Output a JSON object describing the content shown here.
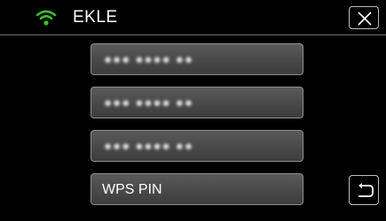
{
  "header": {
    "title": "EKLE",
    "wifi_icon": "wifi-icon",
    "wifi_color": "#3bbf2a",
    "close_icon": "close-icon"
  },
  "list": {
    "items": [
      {
        "label": "●●● ●●●● ●●",
        "blurred": true
      },
      {
        "label": "●●● ●●●● ●●",
        "blurred": true
      },
      {
        "label": "●●● ●●●● ●●",
        "blurred": true
      },
      {
        "label": "WPS PIN",
        "blurred": false
      }
    ]
  },
  "footer": {
    "back_icon": "return-arrow-icon"
  }
}
